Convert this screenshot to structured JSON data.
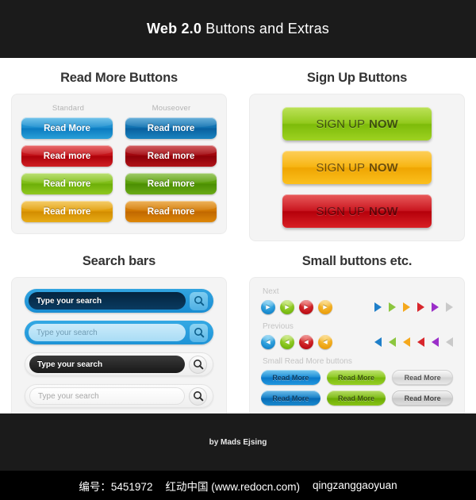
{
  "header": {
    "title_strong": "Web 2.0",
    "title_light": " Buttons and Extras"
  },
  "sections": {
    "read_more": {
      "title": "Read More Buttons",
      "columns": [
        "Standard",
        "Mouseover"
      ],
      "standard": [
        "Read More",
        "Read more",
        "Read more",
        "Read more"
      ],
      "mouseover": [
        "Read more",
        "Read more",
        "Read more",
        "Read more"
      ]
    },
    "sign_up": {
      "title": "Sign Up Buttons",
      "buttons": [
        {
          "text_light": "SIGN UP",
          "text_bold": "NOW",
          "color": "#8fc816"
        },
        {
          "text_light": "SIGN UP",
          "text_bold": "NOW",
          "color": "#f7b30b"
        },
        {
          "text_light": "SIGN UP",
          "text_bold": "NOW",
          "color": "#c8101a"
        }
      ]
    },
    "search_bars": {
      "title": "Search bars",
      "bars": [
        {
          "placeholder": "Type your search",
          "style": "dark-blue"
        },
        {
          "placeholder": "Type your search",
          "style": "light-blue"
        },
        {
          "placeholder": "Type your search",
          "style": "black"
        },
        {
          "placeholder": "Type your search",
          "style": "light-gray"
        }
      ]
    },
    "small_buttons": {
      "title": "Small buttons etc.",
      "next_label": "Next",
      "previous_label": "Previous",
      "small_rm_label": "Small Read More buttons",
      "circle_colors": [
        "#1a8cd0",
        "#79bb12",
        "#c1121a",
        "#eda211"
      ],
      "triangle_colors": [
        "#1f7fc9",
        "#8cc63f",
        "#f5a81c",
        "#d8262c",
        "#9b2fc9",
        "#c9c9c9"
      ],
      "small_read_more": {
        "row1": [
          "Read More",
          "Read More",
          "Read More"
        ],
        "row2": [
          "Read More",
          "Read More",
          "Read More"
        ]
      }
    }
  },
  "footer": {
    "credit": "by Mads Ejsing",
    "bottom_id": "编号：5451972",
    "bottom_site": "红动中国 (www.redocn.com)",
    "bottom_user": "qingzanggaoyuan"
  }
}
